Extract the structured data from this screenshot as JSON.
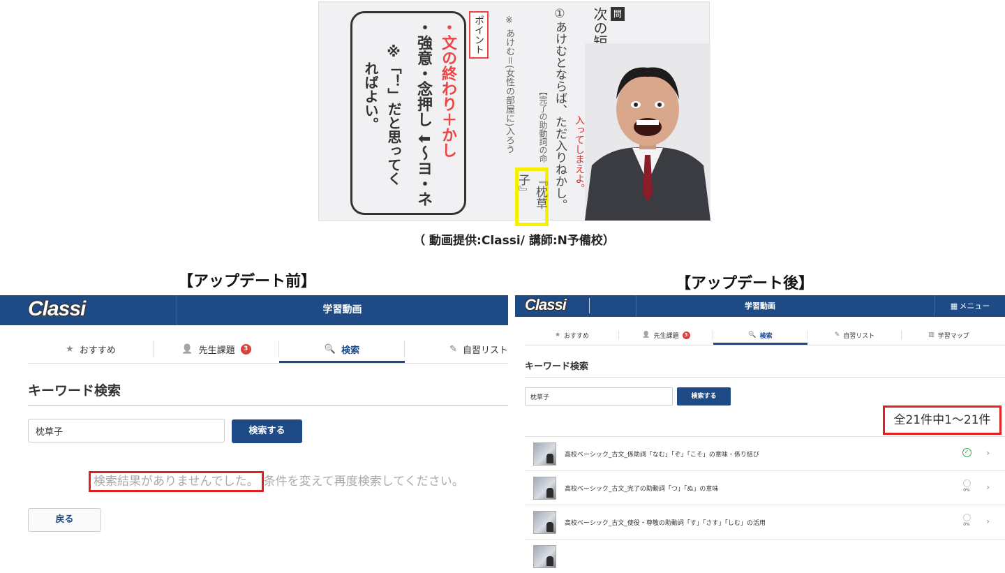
{
  "video": {
    "question_label": "問",
    "question_text": "次の短文の傍線の「訳」を考",
    "item_text": "①あけむとならば、ただ入りねかし。",
    "hint_red": "入ってしまえよ。",
    "hint_grammar": "【完了の助動詞の命",
    "note": "※ あけむ＝(女性の部屋に)入ろう",
    "source": "『枕草子』",
    "point_label": "ポイント",
    "point_1": "・文の終わり＋かし",
    "point_2": "・強意・念押し ⬇〜ヨ・ネ",
    "point_3": "※「！」だと思ってく",
    "point_4": "ればよい。"
  },
  "caption": "（ 動画提供:Classi/ 講師:N予備校）",
  "before": {
    "section_title": "【アップデート前】",
    "logo": "Classi",
    "header_title": "学習動画",
    "tabs": [
      {
        "icon": "★",
        "label": "おすすめ"
      },
      {
        "icon": "👤",
        "label": "先生課題",
        "badge": "3"
      },
      {
        "icon": "🔍",
        "label": "検索"
      },
      {
        "icon": "✎",
        "label": "自習リスト"
      }
    ],
    "keyword_title": "キーワード検索",
    "search_value": "枕草子",
    "search_button": "検索する",
    "result_highlight": "検索結果がありませんでした。",
    "result_rest": "条件を変えて再度検索してください。",
    "back_button": "戻る"
  },
  "after": {
    "section_title": "【アップデート後】",
    "logo": "Classi",
    "header_title": "学習動画",
    "menu_icon": "▦",
    "menu_label": "メニュー",
    "tabs": [
      {
        "icon": "★",
        "label": "おすすめ"
      },
      {
        "icon": "👤",
        "label": "先生課題",
        "badge": "3"
      },
      {
        "icon": "🔍",
        "label": "検索"
      },
      {
        "icon": "✎",
        "label": "自習リスト"
      },
      {
        "icon": "▥",
        "label": "学習マップ"
      }
    ],
    "keyword_title": "キーワード検索",
    "search_value": "枕草子",
    "search_button": "検索する",
    "result_count": "全21件中1〜21件",
    "results": [
      {
        "title": "高校ベーシック_古文_係助詞「なむ」「ぞ」「こそ」の意味・係り結び",
        "status": "done"
      },
      {
        "title": "高校ベーシック_古文_完了の助動詞「つ」「ぬ」の意味",
        "status": "progress",
        "percent": "0%"
      },
      {
        "title": "高校ベーシック_古文_使役・尊敬の助動詞「す」「さす」「しむ」の活用",
        "status": "progress",
        "percent": "0%"
      }
    ]
  }
}
